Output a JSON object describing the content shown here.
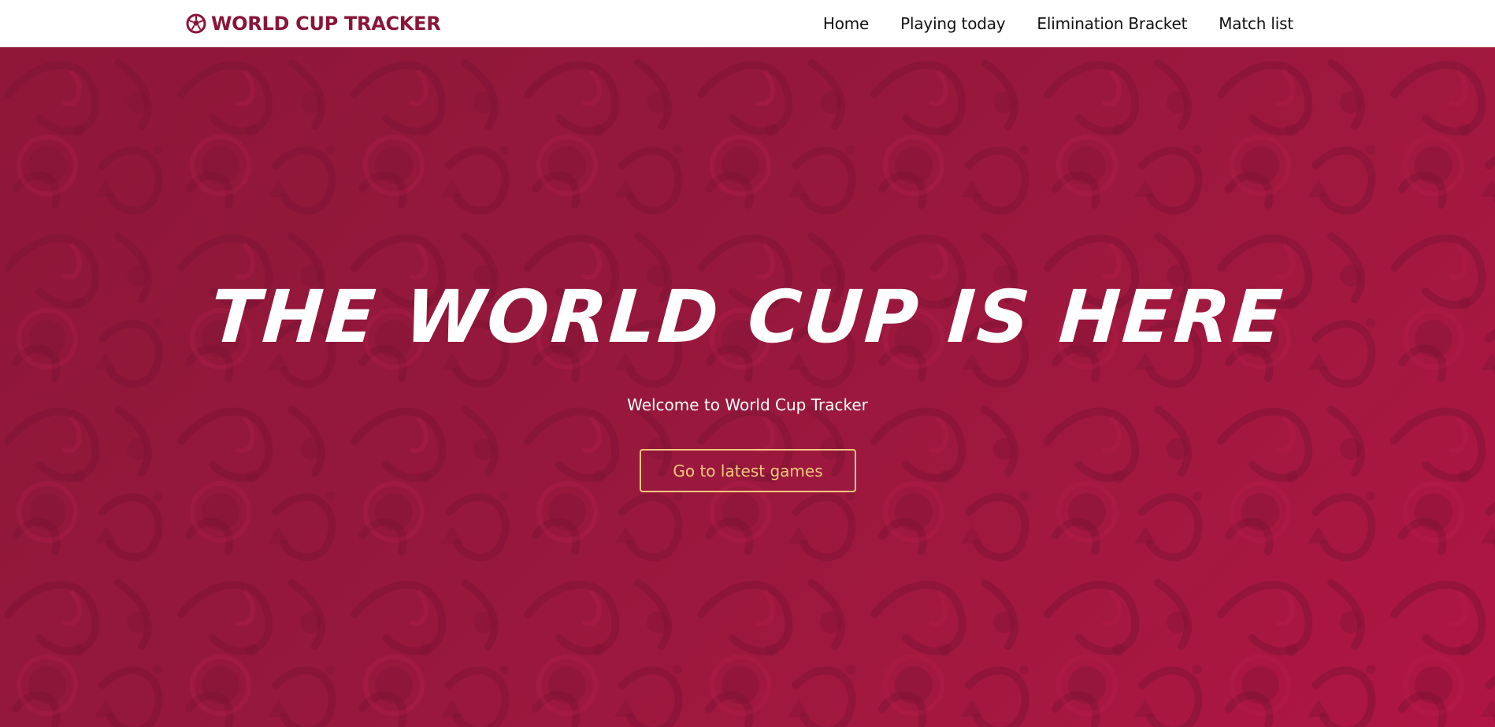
{
  "nav": {
    "brand": "WORLD CUP TRACKER",
    "brand_icon": "soccer-ball-icon",
    "links": [
      "Home",
      "Playing today",
      "Elimination Bracket",
      "Match list"
    ]
  },
  "hero": {
    "title": "THE WORLD CUP IS HERE",
    "subtitle": "Welcome to World Cup Tracker",
    "cta_label": "Go to latest games"
  },
  "colors": {
    "brand": "#8a1538",
    "hero_bg": "#9a173d",
    "cta_border": "#f2c77e",
    "title_text": "#ffffff"
  }
}
